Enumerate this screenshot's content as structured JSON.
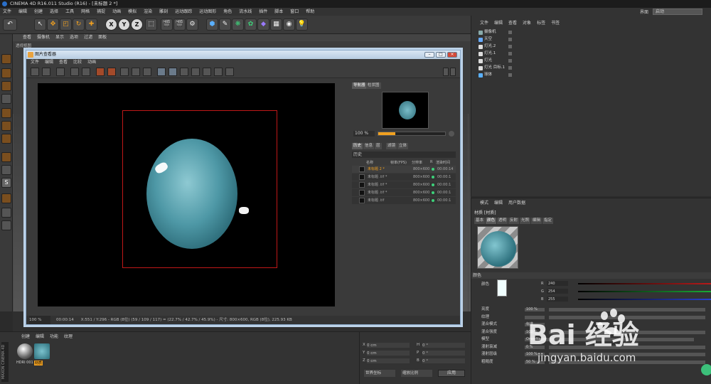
{
  "app": {
    "title": "CINEMA 4D R16.011 Studio (R16) - [未标题 2 *]"
  },
  "menubar": [
    "文件",
    "编辑",
    "创建",
    "选择",
    "工具",
    "网格",
    "捕捉",
    "动画",
    "模拟",
    "渲染",
    "雕刻",
    "运动跟踪",
    "运动图形",
    "角色",
    "流水线",
    "插件",
    "脚本",
    "窗口",
    "帮助"
  ],
  "layout": {
    "label": "界面",
    "value": "启动"
  },
  "viewport": {
    "menu": [
      "查看",
      "摄像机",
      "显示",
      "选项",
      "过滤",
      "面板"
    ],
    "label": "透视视图"
  },
  "picture_viewer": {
    "title": "图片查看器",
    "menu": [
      "文件",
      "编辑",
      "查看",
      "比较",
      "动画"
    ],
    "tabs": [
      "导航器",
      "柱状图"
    ],
    "zoom": "100 %",
    "history_tabs": [
      "历史",
      "信息",
      "层",
      "滤镜",
      "立体"
    ],
    "history_title": "历史",
    "columns": [
      "名称",
      "帧率(FPS)",
      "分辨率",
      "R",
      "渲染时间"
    ],
    "rows": [
      {
        "name": "未标题 2 *",
        "res": "800×600",
        "time": "00:00:14"
      },
      {
        "name": "未标题 .tif *",
        "res": "800×600",
        "time": "00:00:1"
      },
      {
        "name": "未标题 .tif *",
        "res": "800×600",
        "time": "00:00:1"
      },
      {
        "name": "未标题 .tif *",
        "res": "800×600",
        "time": "00:00:1"
      },
      {
        "name": "未标题 .tif",
        "res": "800×600",
        "time": "00:00:1"
      }
    ],
    "status": {
      "zoom": "100 %",
      "time": "00:00:14",
      "info": "X:551 / Y:296 - RGB (8位) (59 / 109 / 117) = (22.7% / 42.7% / 45.9%) - 尺寸: 800×600, RGB (8位), 225.93 KB"
    }
  },
  "objects": {
    "menu": [
      "文件",
      "编辑",
      "查看",
      "对象",
      "标签",
      "书签"
    ],
    "items": [
      "摄像机",
      "天空",
      "灯光.2",
      "灯光.1",
      "灯光",
      "灯光 目标.1",
      "球体"
    ]
  },
  "attributes": {
    "menu": [
      "模式",
      "编辑",
      "用户数据"
    ],
    "material_title": "材质 [材质]",
    "tabs": [
      "基本",
      "颜色",
      "透明",
      "反射",
      "光照",
      "编辑",
      "指定"
    ],
    "section": "颜色",
    "color_label": "颜色",
    "r": "240",
    "g": "254",
    "b": "255",
    "rows": [
      {
        "label": "亮度",
        "value": "100 %"
      },
      {
        "label": "纹理",
        "value": ""
      },
      {
        "label": "混合模式",
        "value": "标准"
      },
      {
        "label": "混合强度",
        "value": "100 %"
      },
      {
        "label": "模型",
        "value": "Oren-Nayar"
      },
      {
        "label": "漫射衰减",
        "value": "0 %"
      },
      {
        "label": "漫射层级",
        "value": "100 %"
      },
      {
        "label": "粗糙度",
        "value": "50 %"
      }
    ]
  },
  "materials": {
    "menu": [
      "创建",
      "编辑",
      "功能",
      "纹理"
    ],
    "items": [
      "HDRI 001",
      "材质"
    ]
  },
  "coords": {
    "rows": [
      {
        "a": "X",
        "av": "0 cm",
        "b": "H",
        "bv": "0 °"
      },
      {
        "a": "Y",
        "av": "0 cm",
        "b": "P",
        "bv": "0 °"
      },
      {
        "a": "Z",
        "av": "0 cm",
        "b": "B",
        "bv": "0 °"
      }
    ],
    "world": "世界坐标",
    "scale": "缩放比例",
    "apply": "应用"
  },
  "watermark": {
    "brand": "Bai  经验",
    "url": "jingyan.baidu.com"
  },
  "brand_side": "MAXON CINEMA 4D",
  "colors": {
    "accent": "#f0a020",
    "frame": "#c01818",
    "sphere": "#4e98a6",
    "green": "#3dd17a"
  }
}
